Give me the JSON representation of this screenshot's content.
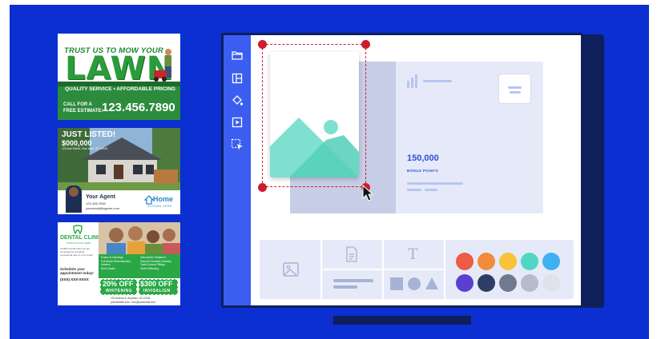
{
  "colors": {
    "background": "#0b2fd0",
    "monitor_shadow": "#0e1f5c",
    "sidebar": "#3b5ef0",
    "canvas": "#ffffff",
    "card": "#e6eaf8",
    "card_dark": "#c7cde6",
    "selection": "#cc1f2e",
    "accent_blue": "#2b4fd8"
  },
  "flyers": {
    "lawn": {
      "headline": "TRUST US TO MOW YOUR",
      "big_word": "LAWN",
      "tagline": "QUALITY SERVICE • AFFORDABLE PRICING",
      "cta_line1": "CALL FOR A",
      "cta_line2": "FREE ESTIMATE:",
      "phone": "123.456.7890"
    },
    "real_estate": {
      "headline": "JUST LISTED!",
      "price": "$000,000",
      "address": "123 Ave Street, Your town, ST 12345",
      "agent_title": "Your Agent",
      "agent_phone": "123-456-7890",
      "agent_email": "youremail@agents.com",
      "brand": "Home",
      "brand_slogan": "SLOGAN HERE"
    },
    "dental": {
      "title": "DENTAL CLINIC",
      "subtitle": "YOUR SLOGAN HERE",
      "intro": "At ABC Dental Clinic we are committed to providing exceptional care for your smile.",
      "schedule": "Schedule your appointment today!",
      "phone": "(XXX) XXX-XXXX",
      "services_left": [
        "Exams & Cleanings",
        "Full Mouth Reconstruction",
        "Veneers",
        "Root Canals"
      ],
      "services_right": [
        "Orthodontic Treatment",
        "General Cosmetic Dentistry",
        "Tooth-Colored Fillings",
        "Teeth Whitening"
      ],
      "offer1_value": "20% OFF",
      "offer1_label": "WHITENING",
      "offer2_value": "$300 OFF",
      "offer2_label": "INVISALIGN",
      "address": "123 Avenue A, Anytown, US 12345",
      "website": "yourwebsite.com",
      "email": "info@youremail.com"
    }
  },
  "editor": {
    "sidebar_icons": [
      "folder-icon",
      "layout-icon",
      "paint-bucket-icon",
      "play-icon",
      "select-tool-icon"
    ],
    "card": {
      "stat_value": "150,000",
      "stat_label": "BONUS POINTS"
    },
    "palette": {
      "row1": [
        "#ee5a45",
        "#f08c3a",
        "#f8c23a",
        "#4fd6c4",
        "#3fb0f0"
      ],
      "row2": [
        "#5a3fd0",
        "#2f3e66",
        "#6f7a90",
        "#b6bccb",
        "#dfe2eb"
      ]
    },
    "text_tool_glyph": "T"
  }
}
